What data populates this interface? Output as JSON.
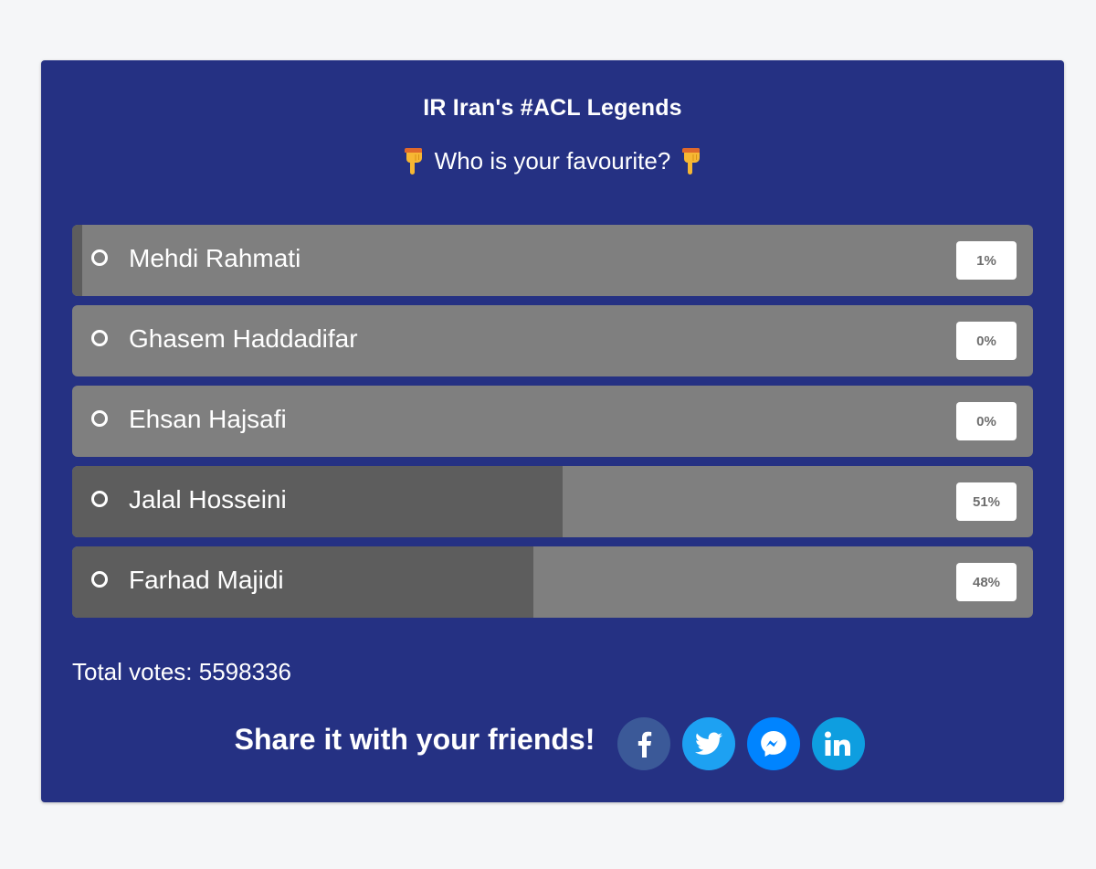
{
  "poll": {
    "title": "IR Iran's #ACL Legends",
    "question": "Who is your favourite?",
    "question_icon": "backhand-index-pointing-down-icon",
    "options": [
      {
        "label": "Mehdi Rahmati",
        "percent_label": "1%",
        "percent": 1
      },
      {
        "label": "Ghasem Haddadifar",
        "percent_label": "0%",
        "percent": 0
      },
      {
        "label": "Ehsan Hajsafi",
        "percent_label": "0%",
        "percent": 0
      },
      {
        "label": "Jalal Hosseini",
        "percent_label": "51%",
        "percent": 51
      },
      {
        "label": "Farhad Majidi",
        "percent_label": "48%",
        "percent": 48
      }
    ],
    "total_votes": "Total votes: 5598336"
  },
  "share": {
    "text": "Share it with your friends!",
    "buttons": [
      {
        "name": "facebook",
        "icon": "facebook-icon",
        "color": "#3b5998"
      },
      {
        "name": "twitter",
        "icon": "twitter-icon",
        "color": "#1da1f2"
      },
      {
        "name": "messenger",
        "icon": "messenger-icon",
        "color": "#0084ff"
      },
      {
        "name": "linkedin",
        "icon": "linkedin-icon",
        "color": "#0e9ee0"
      }
    ]
  },
  "colors": {
    "page_background": "#f5f6f8",
    "card_background": "#253183",
    "option_background": "#7f7f7f",
    "option_fill": "#5d5d5d"
  }
}
